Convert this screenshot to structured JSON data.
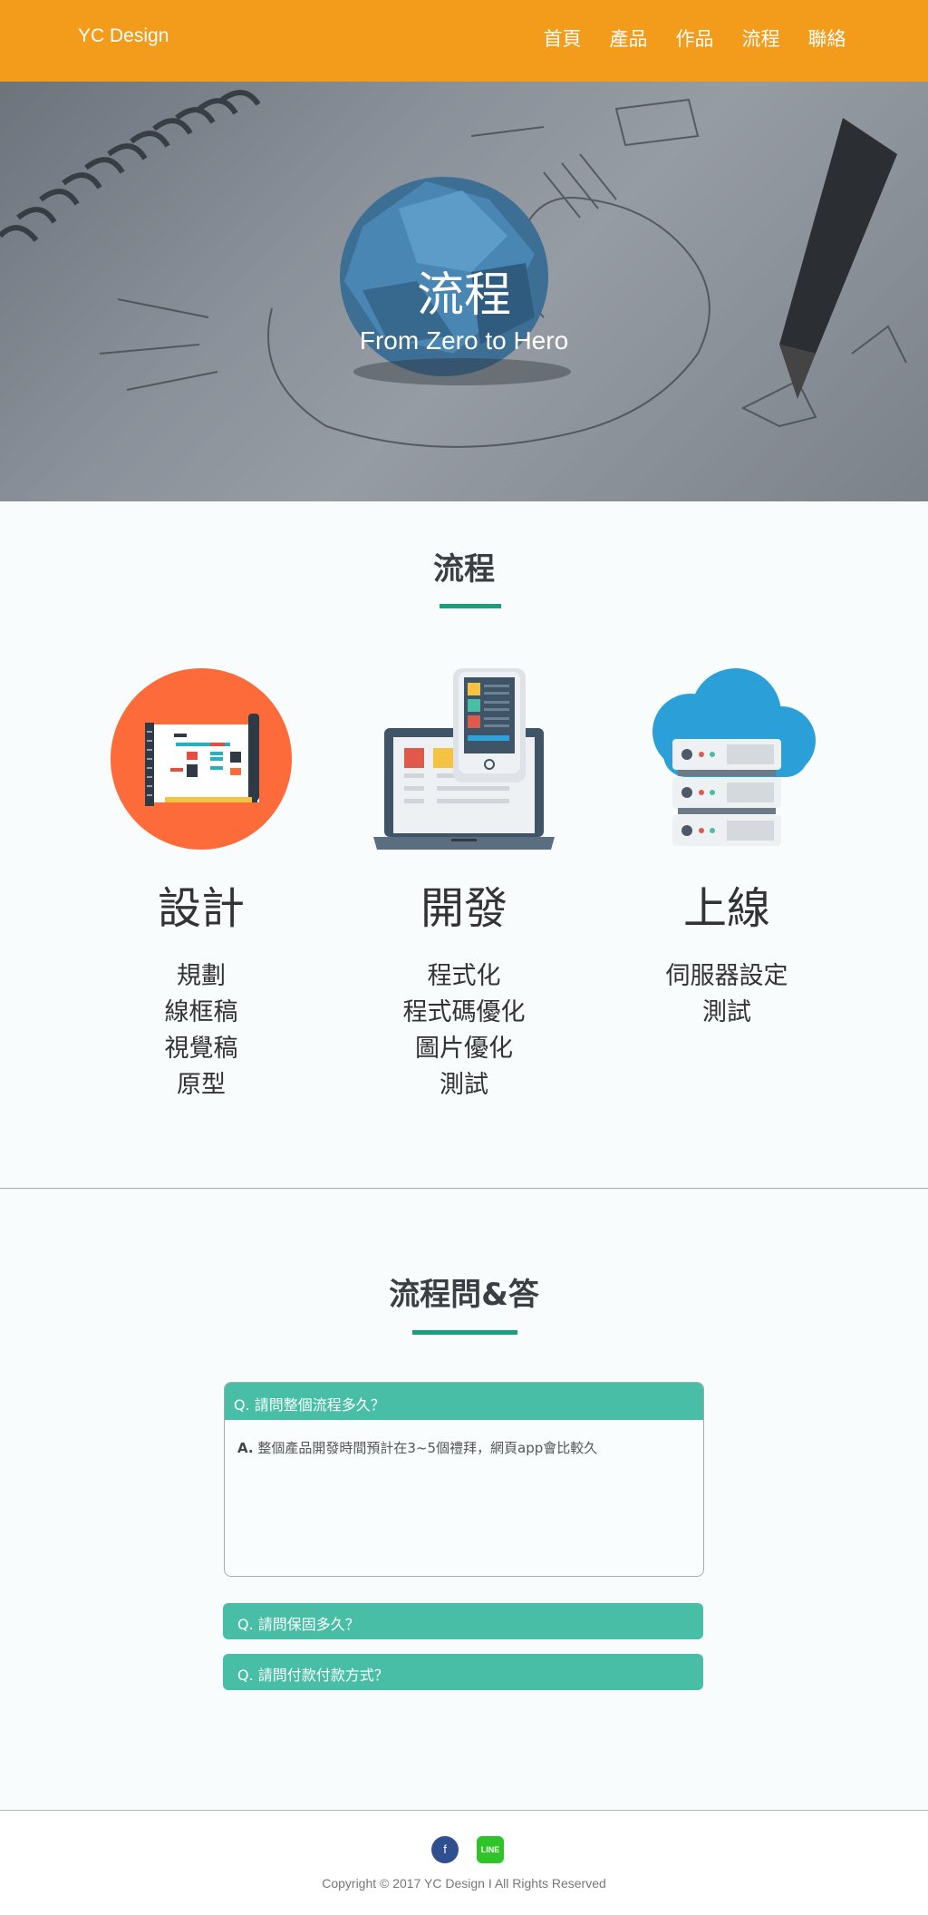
{
  "header": {
    "brand": "YC Design",
    "nav": [
      "首頁",
      "產品",
      "作品",
      "流程",
      "聯絡"
    ],
    "background": "#f39c1b"
  },
  "hero": {
    "title": "流程",
    "subtitle": "From Zero to Hero"
  },
  "process": {
    "title": "流程",
    "accent": "#1a9e7e",
    "steps": [
      {
        "name": "設計",
        "icon": "blueprint-icon",
        "items": [
          "規劃",
          "線框稿",
          "視覺稿",
          "原型"
        ]
      },
      {
        "name": "開發",
        "icon": "laptop-phone-icon",
        "items": [
          "程式化",
          "程式碼優化",
          "圖片優化",
          "測試"
        ]
      },
      {
        "name": "上線",
        "icon": "cloud-server-icon",
        "items": [
          "伺服器設定",
          "測試"
        ]
      }
    ]
  },
  "faq": {
    "title": "流程問&答",
    "items": [
      {
        "question": "Q. 請問整個流程多久？",
        "answer_prefix": "A.",
        "answer": "整個產品開發時間預計在3~5個禮拜，網頁app會比較久",
        "expanded": true
      },
      {
        "question": "Q. 請問保固多久？",
        "expanded": false
      },
      {
        "question": "Q. 請問付款付款方式？",
        "expanded": false
      }
    ],
    "accent": "#48bea6"
  },
  "footer": {
    "facebook_icon": "f",
    "line_icon": "LINE",
    "copyright": "Copyright © 2017 YC Design I All Rights Reserved"
  }
}
